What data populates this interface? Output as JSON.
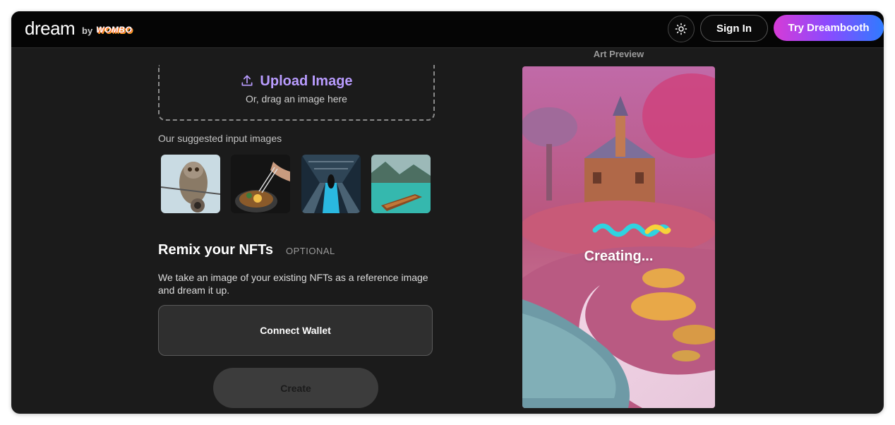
{
  "header": {
    "logo_main": "dream",
    "logo_by": "by",
    "logo_brand": "WOMBO",
    "theme_toggle_icon": "sun-icon",
    "sign_in_label": "Sign In",
    "dreambooth_label": "Try Dreambooth"
  },
  "upload": {
    "icon": "upload-icon",
    "title": "Upload Image",
    "subtitle": "Or, drag an image here"
  },
  "suggested": {
    "label": "Our suggested input images",
    "images": [
      {
        "subject": "owl"
      },
      {
        "subject": "food-with-chopsticks"
      },
      {
        "subject": "escalator-tunnel"
      },
      {
        "subject": "boat-on-lake"
      }
    ]
  },
  "remix": {
    "title": "Remix your NFTs",
    "optional": "OPTIONAL",
    "description": "We take an image of your existing NFTs as a reference image and dream it up.",
    "connect_label": "Connect Wallet"
  },
  "create": {
    "label": "Create"
  },
  "preview": {
    "label": "Art Preview",
    "status": "Creating..."
  },
  "colors": {
    "accent_purple": "#b99cff",
    "gradient_start": "#d63bd6",
    "gradient_end": "#2f7bff",
    "background": "#1b1b1b"
  }
}
